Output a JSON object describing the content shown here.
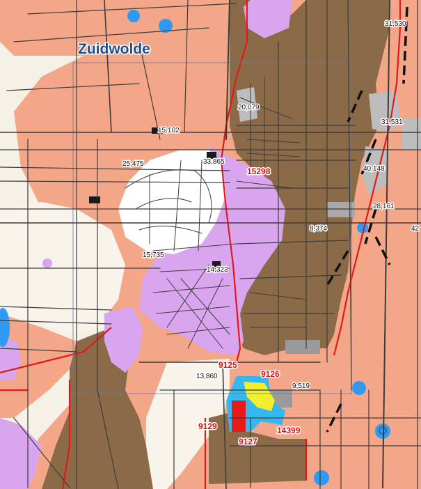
{
  "place_name": "Zuidwolde",
  "colors": {
    "background": "#f6f1e6",
    "salmon": "#f4a688",
    "brown": "#8b6a48",
    "lilac": "#d9a5ee",
    "blue_dots": "#2f9af2",
    "cyan": "#35b7f0",
    "yellow": "#f3ef2e",
    "grey": "#bdbdbd",
    "boundary_red": "#e01a1a",
    "road": "#3c3c3c",
    "label_blue": "#1f4e8c"
  },
  "black_labels": {
    "l31530": "31,530",
    "l20079": "20,079",
    "l31531": "31,531",
    "l15102": "15,102",
    "l25475": "25,475",
    "l33865": "33,865",
    "l40148": "40,148",
    "l28161": "28,161",
    "l8374": "8,374",
    "l42": "42",
    "l15735": "15,735",
    "l14323": "14,323",
    "l13860": "13,860",
    "l9519": "9,519"
  },
  "red_labels": {
    "r15298": "15298",
    "r9125": "9125",
    "r9126": "9126",
    "r9129": "9129",
    "r9127": "9127",
    "r14399": "14399"
  }
}
